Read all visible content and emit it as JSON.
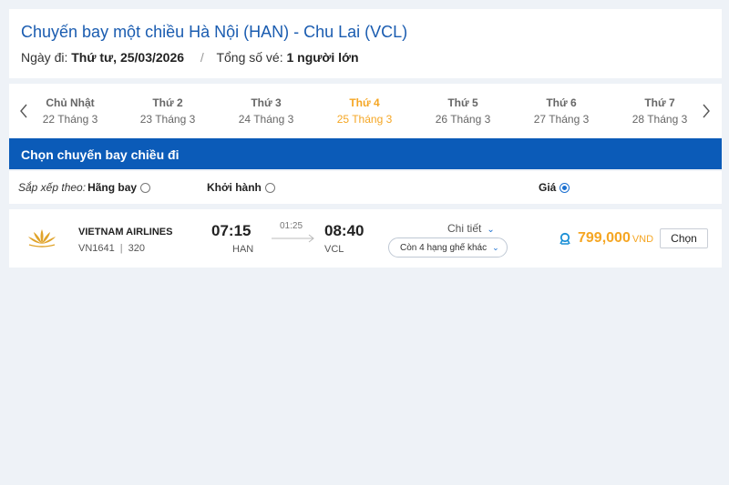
{
  "header": {
    "title": "Chuyến bay một chiều Hà Nội (HAN) - Chu Lai (VCL)",
    "depart_label": "Ngày đi:",
    "depart_value": "Thứ tư, 25/03/2026",
    "tickets_label": "Tổng số vé:",
    "tickets_value": "1 người lớn"
  },
  "date_strip": {
    "days": [
      {
        "dow": "Chủ Nhật",
        "date": "22 Tháng 3",
        "active": false
      },
      {
        "dow": "Thứ 2",
        "date": "23 Tháng 3",
        "active": false
      },
      {
        "dow": "Thứ 3",
        "date": "24 Tháng 3",
        "active": false
      },
      {
        "dow": "Thứ 4",
        "date": "25 Tháng 3",
        "active": true
      },
      {
        "dow": "Thứ 5",
        "date": "26 Tháng 3",
        "active": false
      },
      {
        "dow": "Thứ 6",
        "date": "27 Tháng 3",
        "active": false
      },
      {
        "dow": "Thứ 7",
        "date": "28 Tháng 3",
        "active": false
      }
    ],
    "prev_icon": "chevron-left-icon",
    "next_icon": "chevron-right-icon",
    "active_color": "#f5a623"
  },
  "section": {
    "title": "Chọn chuyến bay chiều đi",
    "color": "#0b5bb8"
  },
  "sort": {
    "prefix": "Sắp xếp theo:",
    "options": [
      {
        "label": "Hãng bay",
        "selected": false
      },
      {
        "label": "Khởi hành",
        "selected": false
      },
      {
        "label": "Giá",
        "selected": true
      }
    ]
  },
  "flight": {
    "airline": "VIETNAM AIRLINES",
    "flight_no": "VN1641",
    "aircraft": "320",
    "dep_time": "07:15",
    "dep_code": "HAN",
    "duration": "01:25",
    "arr_time": "08:40",
    "arr_code": "VCL",
    "detail_label": "Chi tiết",
    "other_classes": "Còn 4 hạng ghế khác",
    "price": "799,000",
    "currency": "VND",
    "select_label": "Chọn",
    "logo_icon": "lotus-logo-icon",
    "seat_icon": "seat-icon",
    "price_color": "#f5a623"
  }
}
